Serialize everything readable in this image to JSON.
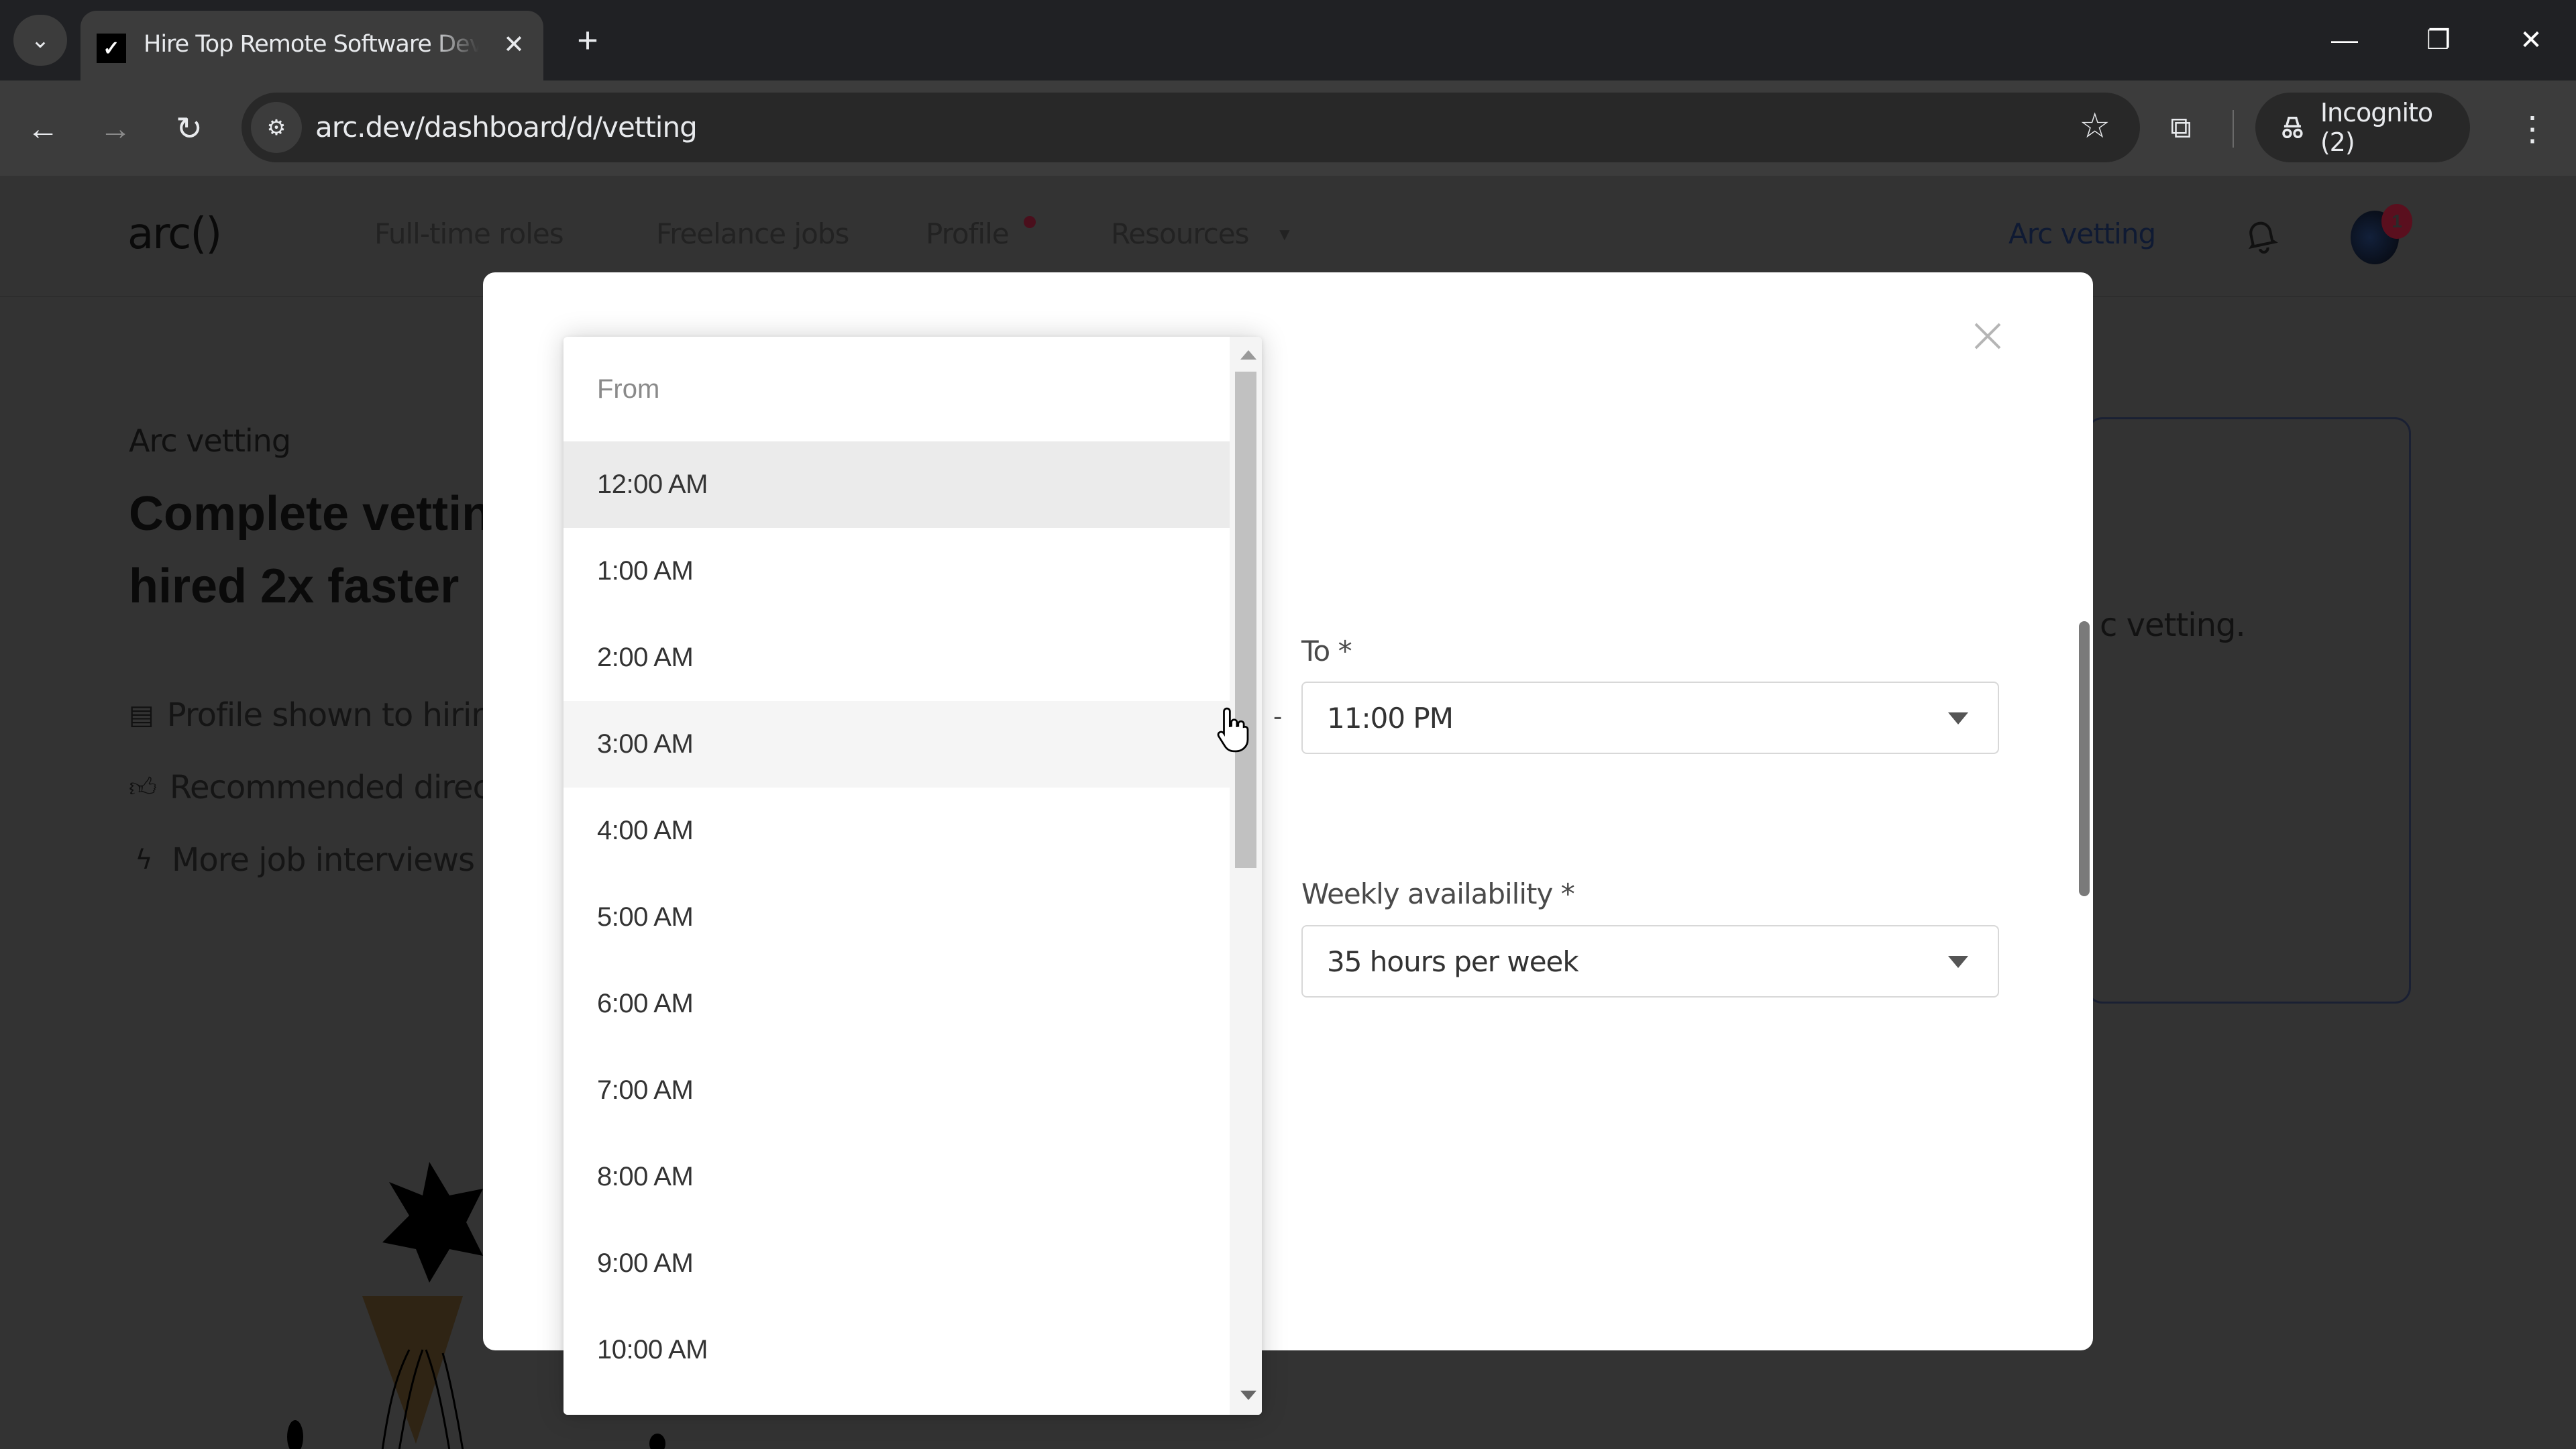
{
  "browser": {
    "tab": {
      "title": "Hire Top Remote Software Developers",
      "favicon": "arc-logo-icon"
    },
    "url": "arc.dev/dashboard/d/vetting",
    "incognito_label": "Incognito (2)",
    "icons": {
      "tab_search": "chevron-down-icon",
      "tab_close": "close-icon",
      "new_tab": "plus-icon",
      "minimize": "minimize-icon",
      "restore": "restore-icon",
      "close": "close-icon",
      "back": "arrow-left-icon",
      "forward": "arrow-right-icon",
      "reload": "reload-icon",
      "site_info": "tune-icon",
      "bookmark": "star-icon",
      "extensions": "puzzle-icon",
      "incognito": "incognito-icon",
      "menu": "kebab-icon"
    }
  },
  "site": {
    "logo": "arc()",
    "nav": [
      {
        "label": "Full-time roles"
      },
      {
        "label": "Freelance jobs"
      },
      {
        "label": "Profile",
        "has_dot": true
      },
      {
        "label": "Resources",
        "has_caret": true
      }
    ],
    "vetting_link": "Arc vetting",
    "notification_count": "1",
    "colors": {
      "accent_dot": "#8b1a34",
      "link": "#1f3a8a"
    }
  },
  "background": {
    "eyebrow": "Arc vetting",
    "title_line1": "Complete vetting",
    "title_line2": "hired 2x faster",
    "benefits": [
      {
        "icon": "document-icon",
        "text": "Profile shown to hiring"
      },
      {
        "icon": "thumbs-up-icon",
        "text": "Recommended directly"
      },
      {
        "icon": "lightning-icon",
        "text": "More job interviews"
      }
    ],
    "card_text": "c vetting."
  },
  "modal": {
    "separator": "-",
    "from_dropdown": {
      "header": "From",
      "options": [
        "12:00 AM",
        "1:00 AM",
        "2:00 AM",
        "3:00 AM",
        "4:00 AM",
        "5:00 AM",
        "6:00 AM",
        "7:00 AM",
        "8:00 AM",
        "9:00 AM",
        "10:00 AM"
      ],
      "selected": "12:00 AM",
      "hovered": "3:00 AM"
    },
    "to": {
      "label": "To *",
      "value": "11:00 PM"
    },
    "weekly_availability": {
      "label": "Weekly availability *",
      "value": "35 hours per week"
    }
  }
}
